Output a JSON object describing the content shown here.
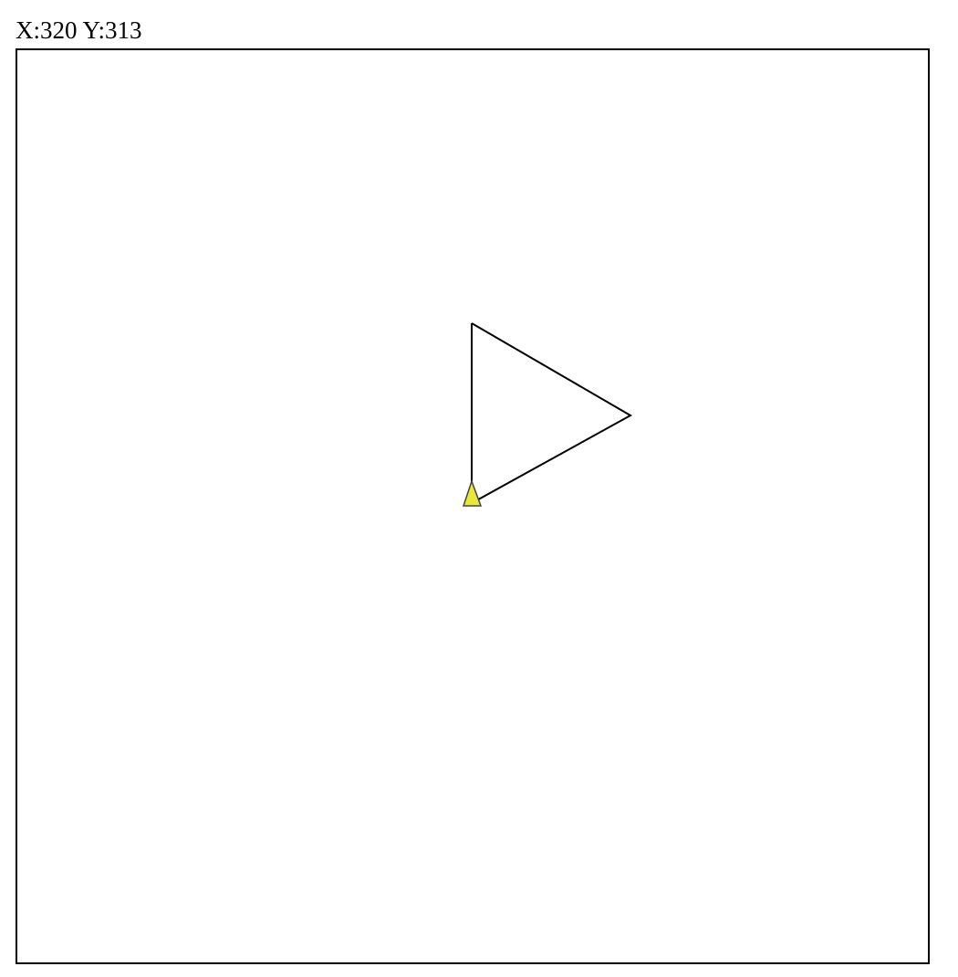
{
  "readout": {
    "x_text": "X:320",
    "y_text": "Y:313"
  },
  "colors": {
    "stroke": "#000000",
    "turtle_fill": "#e8e83a",
    "turtle_outline": "#444444",
    "frame": "#000000",
    "background": "#ffffff"
  },
  "icons": {
    "turtle": "turtle-triangle-icon"
  }
}
